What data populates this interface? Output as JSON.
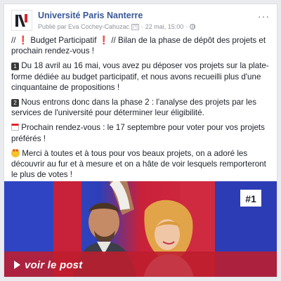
{
  "post": {
    "page_name": "Université Paris Nanterre",
    "author_line": "Publié par Eva Cochey-Cahuzac",
    "badge": "[?]",
    "timestamp": "22 mai, 15:00",
    "more_label": "···",
    "paragraphs": [
      {
        "prefix": "// ",
        "emoji_a": "❗",
        "text": " Budget Participatif ",
        "emoji_b": "❗",
        "text2": " // Bilan de la phase de dépôt des projets et prochain rendez-vous !"
      },
      {
        "emoji": "1",
        "text": " Du 18 avril au 16 mai, vous avez pu déposer vos projets sur la plate-forme dédiée au budget participatif, et nous avons recueilli plus d'une cinquantaine de propositions !"
      },
      {
        "emoji": "2",
        "text": " Nous entrons donc dans la phase 2 : l'analyse des projets par les services de l'université pour déterminer leur éligibilité."
      },
      {
        "text": " Prochain rendez-vous : le 17 septembre pour voter pour vos projets préférés !"
      },
      {
        "text": " Merci à toutes et à tous pour vos beaux projets, on a adoré les découvrir au fur et à mesure et on a hâte de voir lesquels remporteront le plus de votes !"
      }
    ]
  },
  "image": {
    "tag": "#1"
  },
  "cta": {
    "label": "voir le post"
  },
  "colors": {
    "link": "#385898",
    "ribbon": "#be1e2d",
    "blue": "#2d3fb8",
    "red": "#c8213a"
  },
  "icons": {
    "avatar": "nanterre-logo-icon",
    "more": "more-options-icon",
    "play": "play-icon",
    "calendar": "calendar-icon",
    "star_eyes": "star-eyes-emoji-icon"
  }
}
